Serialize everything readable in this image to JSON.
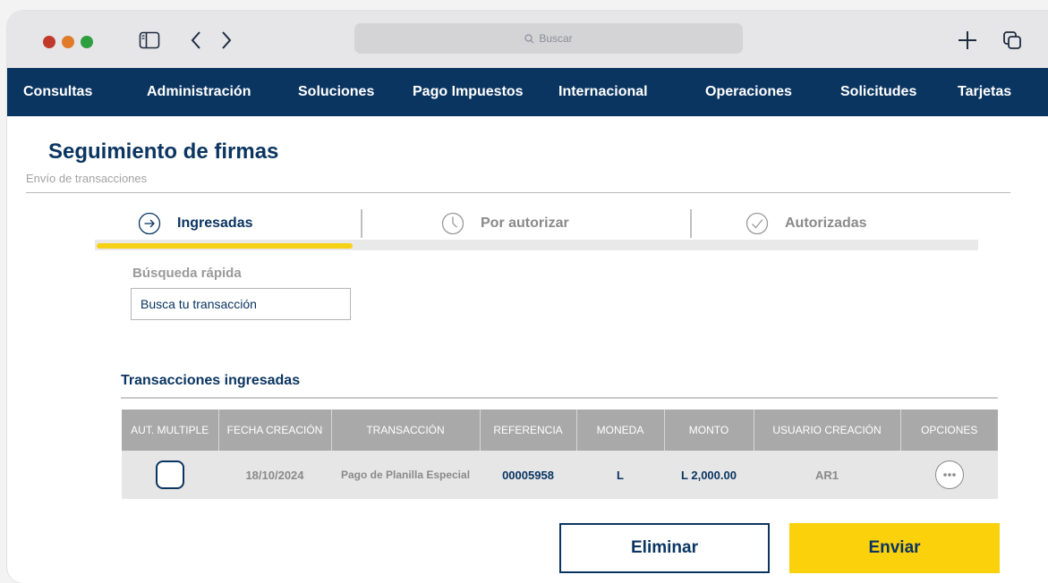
{
  "browser": {
    "search_placeholder": "Buscar"
  },
  "nav": {
    "items": [
      "Consultas",
      "Administración",
      "Soluciones",
      "Pago Impuestos",
      "Internacional",
      "Operaciones",
      "Solicitudes",
      "Tarjetas"
    ]
  },
  "page": {
    "title": "Seguimiento de firmas",
    "subtitle": "Envío de transacciones"
  },
  "steps": {
    "items": [
      {
        "label": "Ingresadas",
        "icon": "arrow-right-circle-icon",
        "active": true
      },
      {
        "label": "Por autorizar",
        "icon": "clock-icon",
        "active": false
      },
      {
        "label": "Autorizadas",
        "icon": "check-circle-icon",
        "active": false
      }
    ],
    "progress": 0.29
  },
  "quick_search": {
    "label": "Búsqueda rápida",
    "placeholder": "Busca tu transacción"
  },
  "table": {
    "title": "Transacciones ingresadas",
    "headers": [
      "AUT. MULTIPLE",
      "FECHA CREACIÓN",
      "TRANSACCIÓN",
      "REFERENCIA",
      "MONEDA",
      "MONTO",
      "USUARIO CREACIÓN",
      "OPCIONES"
    ],
    "rows": [
      {
        "fecha": "18/10/2024",
        "transaccion": "Pago de Planilla Especial",
        "referencia": "00005958",
        "moneda": "L",
        "monto": "L 2,000.00",
        "usuario": "AR1"
      }
    ]
  },
  "actions": {
    "delete_label": "Eliminar",
    "send_label": "Enviar"
  },
  "colors": {
    "brand_navy": "#0b3561",
    "accent_yellow": "#fbd10b"
  }
}
